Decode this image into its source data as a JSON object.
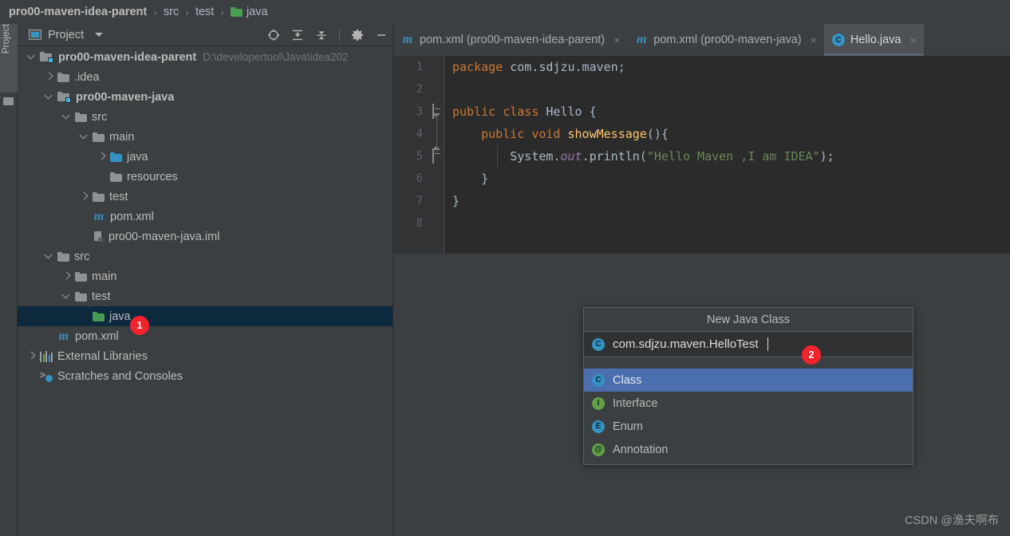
{
  "breadcrumb": {
    "items": [
      {
        "label": "pro00-maven-idea-parent",
        "icon": "none",
        "bold": true
      },
      {
        "label": "src",
        "icon": "none",
        "bold": false
      },
      {
        "label": "test",
        "icon": "none",
        "bold": false
      },
      {
        "label": "java",
        "icon": "folder-green-icon",
        "bold": false
      }
    ],
    "separator": "›"
  },
  "tool_strip": {
    "project_tab_label": "Project"
  },
  "project_panel": {
    "title": "Project",
    "caret": "▼",
    "tools": [
      {
        "name": "select-opened-file-icon",
        "title": "Select Opened File"
      },
      {
        "name": "expand-all-icon",
        "title": "Expand All"
      },
      {
        "name": "collapse-all-icon",
        "title": "Collapse All"
      },
      {
        "name": "settings-gear-icon",
        "title": "Settings"
      },
      {
        "name": "hide-panel-icon",
        "title": "Hide"
      }
    ],
    "tree": [
      {
        "label": "pro00-maven-idea-parent",
        "indent": 0,
        "arrow": "down",
        "icon": "module-folder-icon",
        "bold": true,
        "path": "D:\\developertool\\Java\\idea202",
        "selected": false
      },
      {
        "label": ".idea",
        "indent": 1,
        "arrow": "right",
        "icon": "folder-icon",
        "bold": false,
        "path": "",
        "selected": false
      },
      {
        "label": "pro00-maven-java",
        "indent": 1,
        "arrow": "down",
        "icon": "module-folder-icon",
        "bold": true,
        "path": "",
        "selected": false
      },
      {
        "label": "src",
        "indent": 2,
        "arrow": "down",
        "icon": "folder-icon",
        "bold": false,
        "path": "",
        "selected": false
      },
      {
        "label": "main",
        "indent": 3,
        "arrow": "down",
        "icon": "folder-icon",
        "bold": false,
        "path": "",
        "selected": false
      },
      {
        "label": "java",
        "indent": 4,
        "arrow": "right",
        "icon": "folder-blue-icon",
        "bold": false,
        "path": "",
        "selected": false
      },
      {
        "label": "resources",
        "indent": 4,
        "arrow": "blank",
        "icon": "folder-icon",
        "bold": false,
        "path": "",
        "selected": false
      },
      {
        "label": "test",
        "indent": 3,
        "arrow": "right",
        "icon": "folder-icon",
        "bold": false,
        "path": "",
        "selected": false
      },
      {
        "label": "pom.xml",
        "indent": 3,
        "arrow": "blank",
        "icon": "maven-icon",
        "bold": false,
        "path": "",
        "selected": false
      },
      {
        "label": "pro00-maven-java.iml",
        "indent": 3,
        "arrow": "blank",
        "icon": "iml-icon",
        "bold": false,
        "path": "",
        "selected": false
      },
      {
        "label": "src",
        "indent": 1,
        "arrow": "down",
        "icon": "folder-icon",
        "bold": false,
        "path": "",
        "selected": false
      },
      {
        "label": "main",
        "indent": 2,
        "arrow": "right",
        "icon": "folder-icon",
        "bold": false,
        "path": "",
        "selected": false
      },
      {
        "label": "test",
        "indent": 2,
        "arrow": "down",
        "icon": "folder-icon",
        "bold": false,
        "path": "",
        "selected": false
      },
      {
        "label": "java",
        "indent": 3,
        "arrow": "blank",
        "icon": "folder-green-icon",
        "bold": false,
        "path": "",
        "selected": true
      },
      {
        "label": "pom.xml",
        "indent": 1,
        "arrow": "blank",
        "icon": "maven-icon",
        "bold": false,
        "path": "",
        "selected": false
      },
      {
        "label": "External Libraries",
        "indent": 0,
        "arrow": "right",
        "icon": "libraries-icon",
        "bold": false,
        "path": "",
        "selected": false
      },
      {
        "label": "Scratches and Consoles",
        "indent": 0,
        "arrow": "blank",
        "icon": "scratches-icon",
        "bold": false,
        "path": "",
        "selected": false
      }
    ]
  },
  "editor": {
    "tabs": [
      {
        "label": "pom.xml (pro00-maven-idea-parent)",
        "icon": "maven-icon",
        "active": false,
        "close": "×"
      },
      {
        "label": "pom.xml (pro00-maven-java)",
        "icon": "maven-icon",
        "active": false,
        "close": "×"
      },
      {
        "label": "Hello.java",
        "icon": "java-class-icon",
        "active": true,
        "close": "×"
      }
    ],
    "line_numbers": [
      "1",
      "2",
      "3",
      "4",
      "5",
      "6",
      "7",
      "8"
    ],
    "code_lines": [
      [
        {
          "t": "package ",
          "c": "kw"
        },
        {
          "t": "com.sdjzu.maven;",
          "c": "cls"
        }
      ],
      [],
      [
        {
          "t": "public class ",
          "c": "kw"
        },
        {
          "t": "Hello ",
          "c": "cls"
        },
        {
          "t": "{",
          "c": "cls"
        }
      ],
      [
        {
          "t": "    public void ",
          "c": "kw"
        },
        {
          "t": "showMessage",
          "c": "mth"
        },
        {
          "t": "(){",
          "c": "cls"
        }
      ],
      [
        {
          "t": "        System.",
          "c": "cls"
        },
        {
          "t": "out",
          "c": "fld"
        },
        {
          "t": ".println(",
          "c": "cls"
        },
        {
          "t": "\"Hello Maven ,I am IDEA\"",
          "c": "str"
        },
        {
          "t": ");",
          "c": "cls"
        }
      ],
      [
        {
          "t": "    }",
          "c": "cls"
        }
      ],
      [
        {
          "t": "}",
          "c": "cls"
        }
      ],
      []
    ]
  },
  "popup": {
    "title": "New Java Class",
    "input_value": "com.sdjzu.maven.HelloTest",
    "input_icon": "java-class-icon",
    "items": [
      {
        "label": "Class",
        "icon": "C",
        "color": "#3592c4",
        "selected": true
      },
      {
        "label": "Interface",
        "icon": "I",
        "color": "#62a144",
        "selected": false
      },
      {
        "label": "Enum",
        "icon": "E",
        "color": "#3592c4",
        "selected": false
      },
      {
        "label": "Annotation",
        "icon": "@",
        "color": "#62a144",
        "selected": false
      }
    ]
  },
  "annotations": [
    {
      "number": "1",
      "target": "tree-row-java-test"
    },
    {
      "number": "2",
      "target": "popup-input"
    }
  ],
  "watermark": "CSDN @渔夫啊布",
  "colors": {
    "panel_bg": "#3c3f41",
    "editor_bg": "#2b2b2b",
    "gutter_bg": "#313335",
    "selection_bg": "#0d293e",
    "popup_selection": "#4b6eaf",
    "accent_blue": "#3592c4",
    "badge_red": "#f3222b",
    "keyword": "#cc7832",
    "string": "#6a8759",
    "method": "#ffc66d",
    "field": "#9876aa",
    "text": "#a9b7c6"
  }
}
